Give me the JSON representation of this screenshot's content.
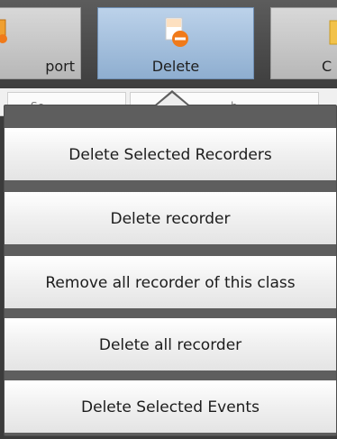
{
  "ribbon": {
    "buttons": [
      {
        "label": "port",
        "icon": "export-icon"
      },
      {
        "label": "Delete",
        "icon": "delete-document-icon"
      },
      {
        "label": "C",
        "icon": "document-icon"
      }
    ]
  },
  "header_strip": {
    "fragments": [
      "Sc",
      "b"
    ]
  },
  "delete_menu": {
    "items": [
      {
        "label": "Delete Selected Recorders"
      },
      {
        "label": "Delete recorder"
      },
      {
        "label": "Remove all recorder of this class"
      },
      {
        "label": "Delete all recorder"
      },
      {
        "label": "Delete Selected Events"
      }
    ]
  },
  "colors": {
    "active_button": "#9fbbd9",
    "menu_item": "#f1f1f1",
    "menu_background": "#5e5e5e",
    "delete_icon_accent": "#f07a1a"
  }
}
